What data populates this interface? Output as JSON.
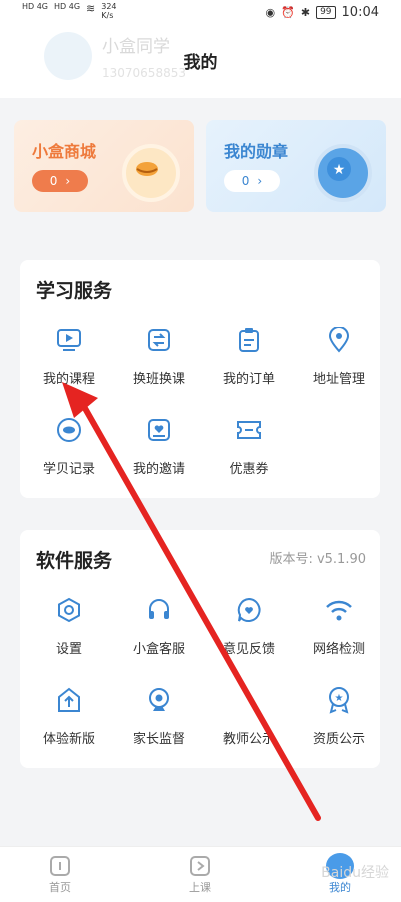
{
  "status": {
    "net1": "HD 4G",
    "net2": "HD 4G",
    "speed_value": "324",
    "speed_unit": "K/s",
    "battery": "99",
    "time": "10:04"
  },
  "header": {
    "title": "我的",
    "user_name": "小盒同学",
    "user_id": "13070658853"
  },
  "cards": {
    "mall": {
      "title": "小盒商城",
      "count": "0"
    },
    "medal": {
      "title": "我的勋章",
      "count": "0"
    }
  },
  "learning": {
    "title": "学习服务",
    "items": [
      {
        "label": "我的课程",
        "icon": "video-icon"
      },
      {
        "label": "换班换课",
        "icon": "swap-icon"
      },
      {
        "label": "我的订单",
        "icon": "clipboard-icon"
      },
      {
        "label": "地址管理",
        "icon": "location-icon"
      },
      {
        "label": "学贝记录",
        "icon": "shell-icon"
      },
      {
        "label": "我的邀请",
        "icon": "invite-icon"
      },
      {
        "label": "优惠券",
        "icon": "coupon-icon"
      }
    ]
  },
  "software": {
    "title": "软件服务",
    "version": "版本号: v5.1.90",
    "items": [
      {
        "label": "设置",
        "icon": "settings-icon"
      },
      {
        "label": "小盒客服",
        "icon": "headset-icon"
      },
      {
        "label": "意见反馈",
        "icon": "feedback-icon"
      },
      {
        "label": "网络检测",
        "icon": "wifi-icon"
      },
      {
        "label": "体验新版",
        "icon": "upgrade-icon"
      },
      {
        "label": "家长监督",
        "icon": "camera-icon"
      },
      {
        "label": "教师公示",
        "icon": "teacher-icon"
      },
      {
        "label": "资质公示",
        "icon": "award-icon"
      }
    ]
  },
  "tabs": [
    {
      "label": "首页",
      "icon": "home-icon"
    },
    {
      "label": "上课",
      "icon": "class-icon"
    },
    {
      "label": "我的",
      "icon": "profile-icon"
    }
  ],
  "colors": {
    "accent": "#3b86d1",
    "mall": "#ee7a3c",
    "arrow": "#e52421"
  },
  "watermark": "Baidu经验"
}
